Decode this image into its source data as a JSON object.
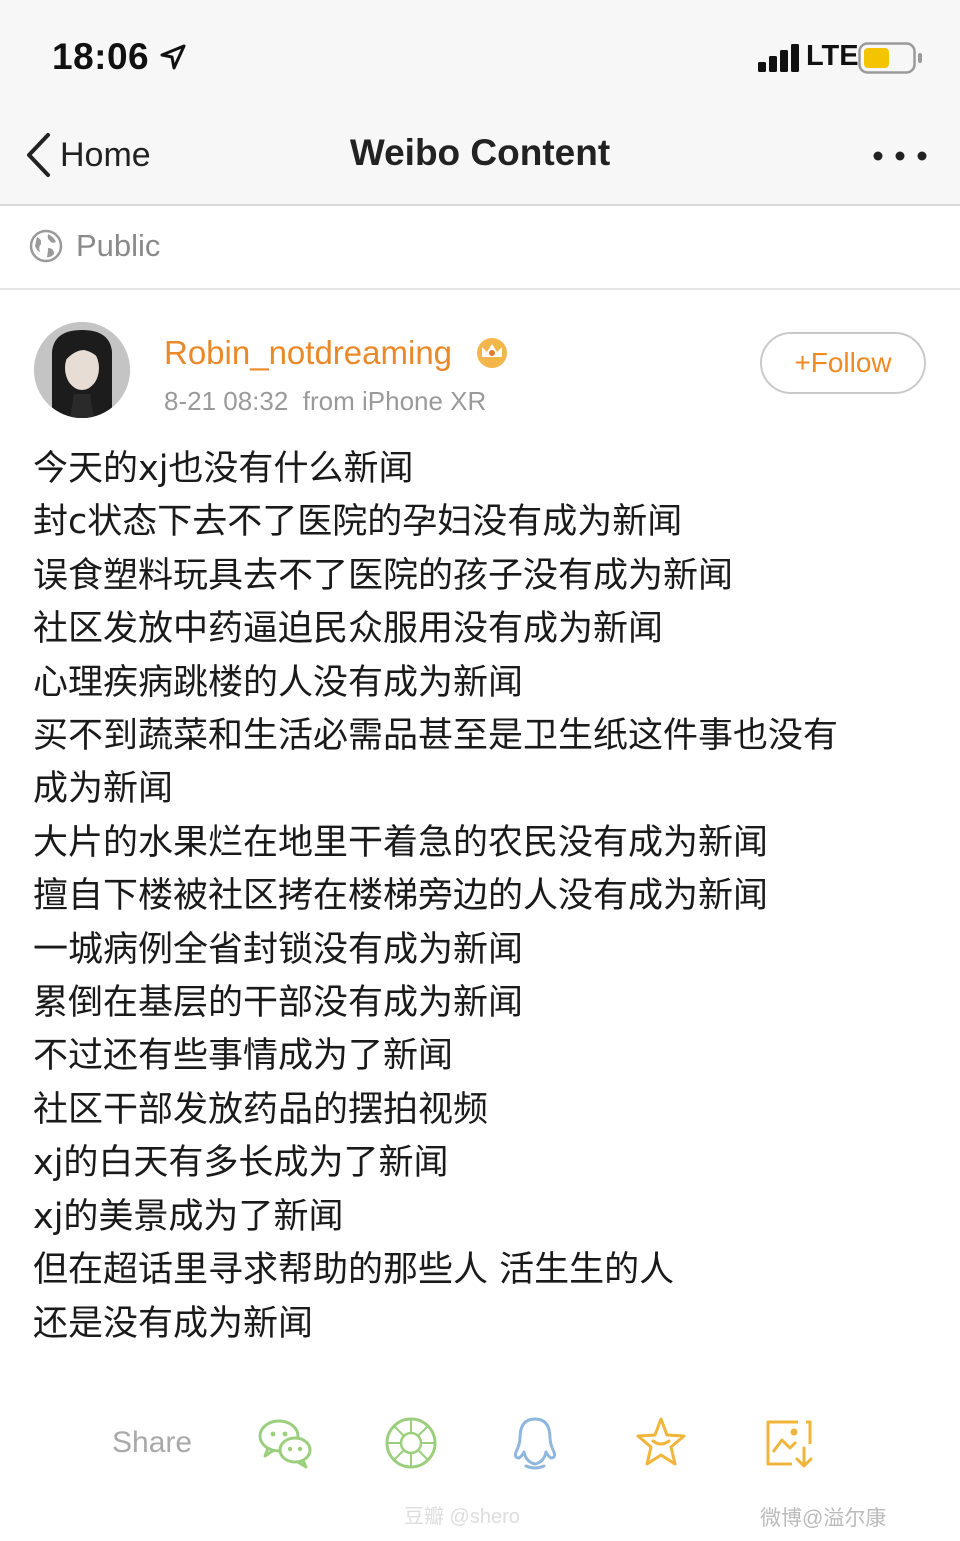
{
  "status_bar": {
    "time": "18:06",
    "network": "LTE",
    "battery_color": "#f5c400"
  },
  "nav": {
    "back_label": "Home",
    "title": "Weibo Content",
    "more_icon": "more-dots-icon"
  },
  "visibility": {
    "label": "Public",
    "icon": "globe-icon"
  },
  "post": {
    "username": "Robin_notdreaming",
    "timestamp": "8-21 08:32",
    "source": "from iPhone XR",
    "follow_label": "+Follow",
    "lines": [
      "今天的xj也没有什么新闻",
      "封c状态下去不了医院的孕妇没有成为新闻",
      "误食塑料玩具去不了医院的孩子没有成为新闻",
      "社区发放中药逼迫民众服用没有成为新闻",
      "心理疾病跳楼的人没有成为新闻",
      "买不到蔬菜和生活必需品甚至是卫生纸这件事也没有",
      "成为新闻",
      "大片的水果烂在地里干着急的农民没有成为新闻",
      "擅自下楼被社区拷在楼梯旁边的人没有成为新闻",
      "一城病例全省封锁没有成为新闻",
      "累倒在基层的干部没有成为新闻",
      "不过还有些事情成为了新闻",
      "社区干部发放药品的摆拍视频",
      "xj的白天有多长成为了新闻",
      "xj的美景成为了新闻",
      "但在超话里寻求帮助的那些人 活生生的人",
      "还是没有成为新闻"
    ]
  },
  "share": {
    "label": "Share",
    "icons": [
      "wechat-icon",
      "moments-icon",
      "qq-icon",
      "favorite-star-icon",
      "save-image-icon"
    ]
  },
  "watermarks": {
    "left": "豆瓣 @shero",
    "right": "微博@溢尔康"
  },
  "colors": {
    "accent": "#f08a22",
    "username": "#e9892a",
    "icon_green": "#9ccf7d",
    "icon_blue": "#8fb7dd",
    "icon_gold": "#f0b53a"
  }
}
